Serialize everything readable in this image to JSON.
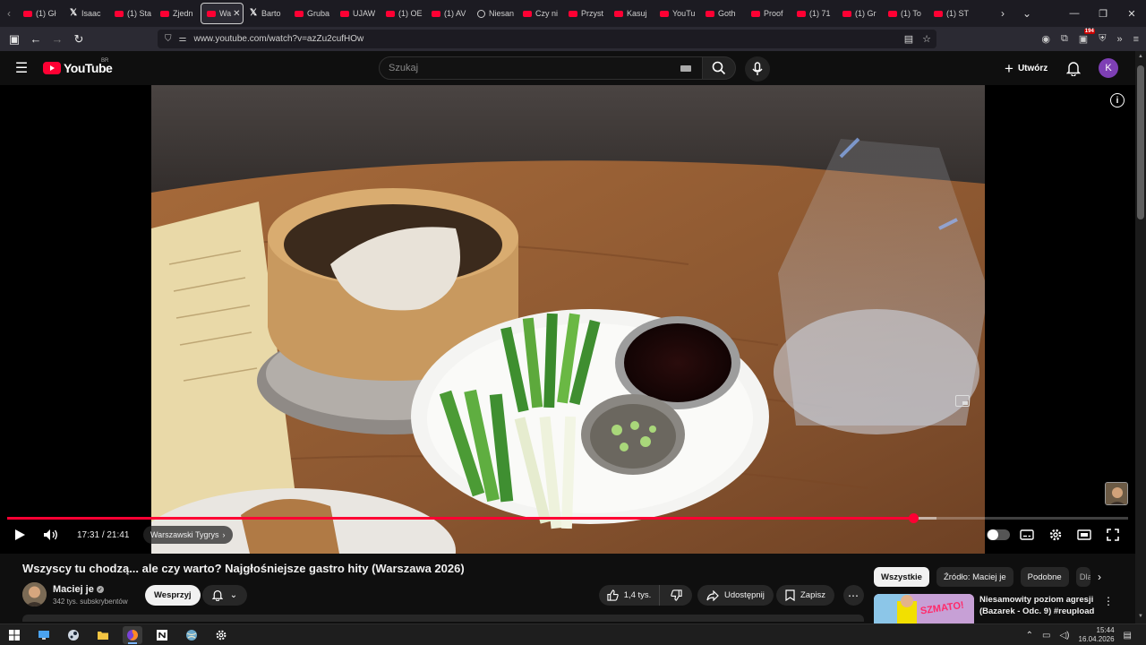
{
  "browser": {
    "tabs": [
      {
        "label": "(1) Gł",
        "icon": "youtube-icon"
      },
      {
        "label": "Isaac",
        "icon": "x-icon"
      },
      {
        "label": "(1) Sta",
        "icon": "youtube-icon"
      },
      {
        "label": "Zjedn",
        "icon": "youtube-icon"
      },
      {
        "label": "Wa",
        "icon": "youtube-icon",
        "active": true
      },
      {
        "label": "Barto",
        "icon": "x-icon"
      },
      {
        "label": "Gruba",
        "icon": "youtube-icon"
      },
      {
        "label": "UJAW",
        "icon": "youtube-icon"
      },
      {
        "label": "(1) OE",
        "icon": "youtube-icon"
      },
      {
        "label": "(1) AV",
        "icon": "youtube-icon"
      },
      {
        "label": "Niesan",
        "icon": "github-icon"
      },
      {
        "label": "Czy ni",
        "icon": "youtube-icon"
      },
      {
        "label": "Przyst",
        "icon": "youtube-icon"
      },
      {
        "label": "Kasuj",
        "icon": "youtube-icon"
      },
      {
        "label": "YouTu",
        "icon": "youtube-icon"
      },
      {
        "label": "Goth",
        "icon": "youtube-icon"
      },
      {
        "label": "Proof",
        "icon": "youtube-icon"
      },
      {
        "label": "(1) 71",
        "icon": "youtube-icon"
      },
      {
        "label": "(1) Gr",
        "icon": "youtube-icon"
      },
      {
        "label": "(1) To",
        "icon": "youtube-icon"
      },
      {
        "label": "(1) ST",
        "icon": "youtube-icon"
      }
    ],
    "url": "www.youtube.com/watch?v=azZu2cufHOw",
    "extension_badge": "194"
  },
  "youtube": {
    "logo_text": "YouTube",
    "region": "BR",
    "search_placeholder": "Szukaj",
    "create_label": "Utwórz",
    "avatar_letter": "K"
  },
  "player": {
    "current_time": "17:31",
    "duration": "21:41",
    "time_separator": "/",
    "progress_fraction": 0.808,
    "buffer_fraction": 0.829,
    "chapter": "Warszawski Tygrys"
  },
  "video": {
    "title": "Wszyscy tu chodzą... ale czy warto? Najgłośniejsze gastro hity (Warszawa 2026)",
    "channel_name": "Maciej je",
    "subscribers": "342 tys. subskrybentów",
    "support_label": "Wesprzyj",
    "likes": "1,4 tys.",
    "share_label": "Udostępnij",
    "save_label": "Zapisz"
  },
  "sidebar": {
    "chips": [
      "Wszystkie",
      "Źródło: Maciej je",
      "Podobne",
      "Dla"
    ],
    "recommended": {
      "title": "Niesamowity poziom agresji (Bazarek - Odc. 9) #reupload",
      "thumb_text": "SZMATO!"
    }
  },
  "taskbar": {
    "time": "15:44",
    "date": "16.04.2026"
  },
  "colors": {
    "accent": "#ff0033",
    "background": "#0f0f0f",
    "chip_bg": "#272727"
  }
}
